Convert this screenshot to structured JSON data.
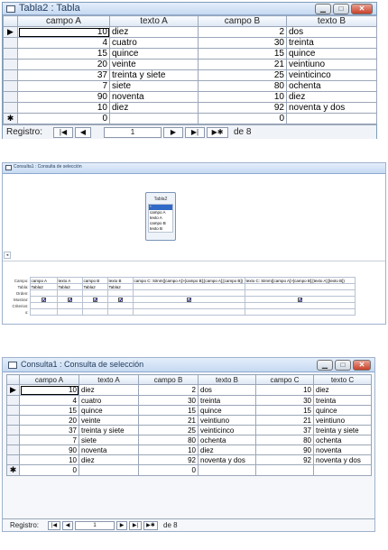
{
  "table_window": {
    "title": "Tabla2 : Tabla",
    "columns": [
      "campo A",
      "texto A",
      "campo B",
      "texto B"
    ],
    "rows": [
      [
        "10",
        "diez",
        "2",
        "dos"
      ],
      [
        "4",
        "cuatro",
        "30",
        "treinta"
      ],
      [
        "15",
        "quince",
        "15",
        "quince"
      ],
      [
        "20",
        "veinte",
        "21",
        "veintiuno"
      ],
      [
        "37",
        "treinta y siete",
        "25",
        "veinticinco"
      ],
      [
        "7",
        "siete",
        "80",
        "ochenta"
      ],
      [
        "90",
        "noventa",
        "10",
        "diez"
      ],
      [
        "10",
        "diez",
        "92",
        "noventa y dos"
      ]
    ],
    "new_row": [
      "0",
      "",
      "0",
      ""
    ],
    "current_marker": "▶",
    "new_marker": "✱",
    "nav": {
      "label": "Registro:",
      "current": "1",
      "of": "de  8"
    }
  },
  "design_window": {
    "title": "Consulta1 : Consulta de selección",
    "field_list": {
      "title": "Tabla2",
      "items": [
        "*",
        "campo A",
        "texto A",
        "campo B",
        "texto B"
      ]
    },
    "row_labels": [
      "Campo:",
      "Tabla:",
      "Orden:",
      "Mostrar:",
      "Criterios:",
      "o:"
    ],
    "columns": [
      {
        "field": "campo A",
        "table": "Tabla2",
        "show": true
      },
      {
        "field": "texto A",
        "table": "Tabla2",
        "show": true
      },
      {
        "field": "campo B",
        "table": "Tabla2",
        "show": true
      },
      {
        "field": "texto B",
        "table": "Tabla2",
        "show": true
      },
      {
        "field": "campo C: SiInm([campo A]>[campo B];[campo A];[campo B])",
        "table": "",
        "show": true
      },
      {
        "field": "texto C: SiInm([campo A]>[campo B];[texto A];[texto B])",
        "table": "",
        "show": true
      }
    ]
  },
  "result_window": {
    "title": "Consulta1 : Consulta de selección",
    "columns": [
      "campo A",
      "texto A",
      "campo B",
      "texto B",
      "campo C",
      "texto C"
    ],
    "rows": [
      [
        "10",
        "diez",
        "2",
        "dos",
        "10",
        "diez"
      ],
      [
        "4",
        "cuatro",
        "30",
        "treinta",
        "30",
        "treinta"
      ],
      [
        "15",
        "quince",
        "15",
        "quince",
        "15",
        "quince"
      ],
      [
        "20",
        "veinte",
        "21",
        "veintiuno",
        "21",
        "veintiuno"
      ],
      [
        "37",
        "treinta y siete",
        "25",
        "veinticinco",
        "37",
        "treinta y siete"
      ],
      [
        "7",
        "siete",
        "80",
        "ochenta",
        "80",
        "ochenta"
      ],
      [
        "90",
        "noventa",
        "10",
        "diez",
        "90",
        "noventa"
      ],
      [
        "10",
        "diez",
        "92",
        "noventa y dos",
        "92",
        "noventa y dos"
      ]
    ],
    "new_row": [
      "0",
      "",
      "0",
      "",
      "",
      ""
    ],
    "current_marker": "▶",
    "new_marker": "✱",
    "nav": {
      "label": "Registro:",
      "current": "1",
      "of": "de  8"
    }
  }
}
